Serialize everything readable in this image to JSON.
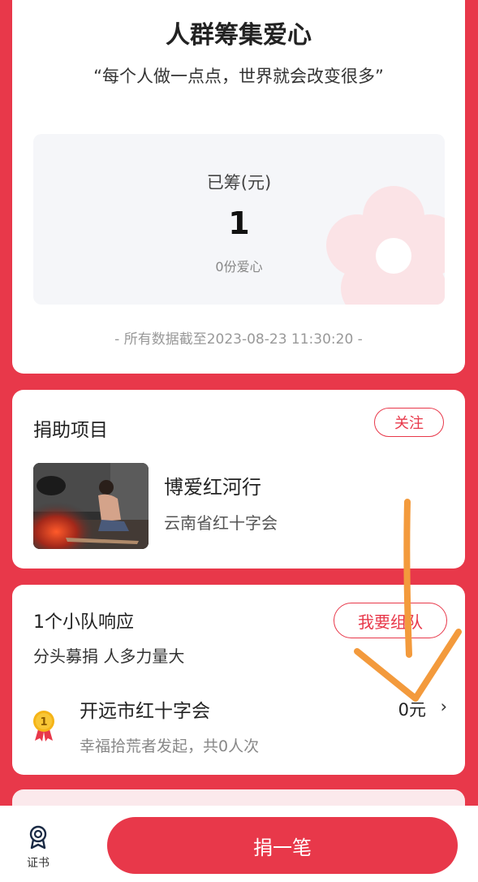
{
  "summary": {
    "title": "人群筹集爱心",
    "slogan": "“每个人做一点点，世界就会改变很多”",
    "raised_label": "已筹(元)",
    "raised_value": "1",
    "love_count": "0份爱心",
    "data_time": "- 所有数据截至2023-08-23 11:30:20 -",
    "flower_icon": "flower-icon",
    "flower_color": "#fbe3e6"
  },
  "project": {
    "section_title": "捐助项目",
    "follow_label": "关注",
    "name": "博爱红河行",
    "org": "云南省红十字会"
  },
  "team": {
    "title": "1个小队响应",
    "subtitle": "分头募捐 人多力量大",
    "join_label": "我要组队",
    "item": {
      "rank": "1",
      "name": "开远市红十字会",
      "desc": "幸福拾荒者发起，共0人次",
      "amount": "0元"
    }
  },
  "bottom": {
    "cert_label": "证书",
    "donate_label": "捐一笔"
  },
  "colors": {
    "accent": "#e8384a",
    "annotation": "#f39a3c",
    "medal": "#f5b417"
  }
}
